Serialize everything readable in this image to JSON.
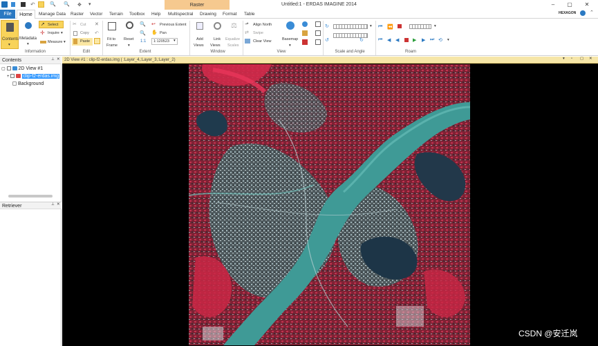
{
  "title_bar": {
    "context_tab": "Raster",
    "app_title": "Untitled:1 - ERDAS IMAGINE 2014",
    "logo_text": "HEXAGON"
  },
  "tabs": [
    "File",
    "Home",
    "Manage Data",
    "Raster",
    "Vector",
    "Terrain",
    "Toolbox",
    "Help",
    "Multispectral",
    "Drawing",
    "Format",
    "Table"
  ],
  "ribbon": {
    "information": {
      "label": "Information",
      "contents": "Contents",
      "metadata": "Metadata",
      "select": "Select",
      "inquire": "Inquire",
      "measure": "Measure"
    },
    "edit": {
      "label": "Edit",
      "cut": "Cut",
      "copy": "Copy",
      "paste": "Paste"
    },
    "extent": {
      "label": "Extent",
      "fit_line1": "Fit to",
      "fit_line2": "Frame",
      "reset": "Reset",
      "previous_extent": "Previous Extent",
      "pan": "Pan",
      "scale_value": "1:120523"
    },
    "window": {
      "label": "Window",
      "add_line1": "Add",
      "add_line2": "Views",
      "link_line1": "Link",
      "link_line2": "Views",
      "equalize_line1": "Equalize",
      "equalize_line2": "Scales"
    },
    "view": {
      "label": "View",
      "align_north": "Align North",
      "swipe": "Swipe",
      "clear_view": "Clear View",
      "basemap": "Basemap"
    },
    "scale_angle": {
      "label": "Scale and Angle"
    },
    "roam": {
      "label": "Roam"
    }
  },
  "contents_panel": {
    "title": "Contents",
    "view_node": "2D View #1",
    "layer_node": "clip-f2-erdas.img",
    "background_node": "Background"
  },
  "retriever_panel": {
    "title": "Retriever"
  },
  "view": {
    "header": "2D View #1 : clip-f2-erdas.img ( :Layer_4,:Layer_3,:Layer_2)"
  },
  "watermark": "CSDN @安迁岚",
  "colors": {
    "file_tab": "#2b79c2",
    "raster_context": "#f6c98f",
    "selected_button": "#f8d35a",
    "view_header": "#f6e6a8",
    "selection_highlight": "#3399ff"
  }
}
